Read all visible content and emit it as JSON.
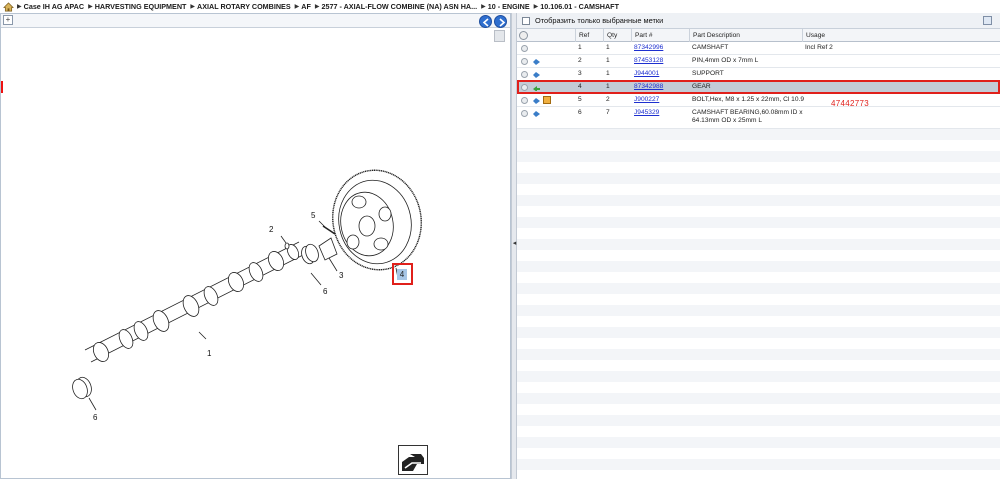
{
  "breadcrumb": [
    "Case IH AG APAC",
    "HARVESTING EQUIPMENT",
    "AXIAL ROTARY COMBINES",
    "AF",
    "2577 - AXIAL-FLOW COMBINE (NA) ASN HA...",
    "10 - ENGINE",
    "10.106.01 - CAMSHAFT"
  ],
  "drawing": {
    "callouts": [
      "1",
      "2",
      "3",
      "5",
      "6",
      "6"
    ],
    "selected_ref": "4"
  },
  "filter": {
    "label": "Отобразить только выбранные метки",
    "checked": false
  },
  "table": {
    "columns": [
      "Ref",
      "Qty",
      "Part #",
      "Part Description",
      "Usage"
    ],
    "rows": [
      {
        "ref": "1",
        "qty": "1",
        "part": "87342996",
        "desc": "CAMSHAFT",
        "desc2": "",
        "usage": "Incl Ref 2"
      },
      {
        "ref": "2",
        "qty": "1",
        "part": "87453128",
        "desc": "PIN,4mm OD x 7mm L",
        "desc2": "",
        "usage": ""
      },
      {
        "ref": "3",
        "qty": "1",
        "part": "J944001",
        "desc": "SUPPORT",
        "desc2": "",
        "usage": ""
      },
      {
        "ref": "4",
        "qty": "1",
        "part": "87342988",
        "desc": "GEAR",
        "desc2": "",
        "usage": ""
      },
      {
        "ref": "5",
        "qty": "2",
        "part": "J900227",
        "desc": "BOLT,Hex, M8 x 1.25 x 22mm, Cl 10.9",
        "desc2": "",
        "usage": ""
      },
      {
        "ref": "6",
        "qty": "7",
        "part": "J945329",
        "desc": "CAMSHAFT BEARING,60.08mm ID x",
        "desc2": "64.13mm OD x 25mm L",
        "usage": ""
      }
    ]
  },
  "annotation": "47442773",
  "colors": {
    "highlight": "#e0201b",
    "link": "#1d2fd0",
    "selected_row": "#c3ccd6",
    "callout_fill": "#a7c6e6"
  }
}
